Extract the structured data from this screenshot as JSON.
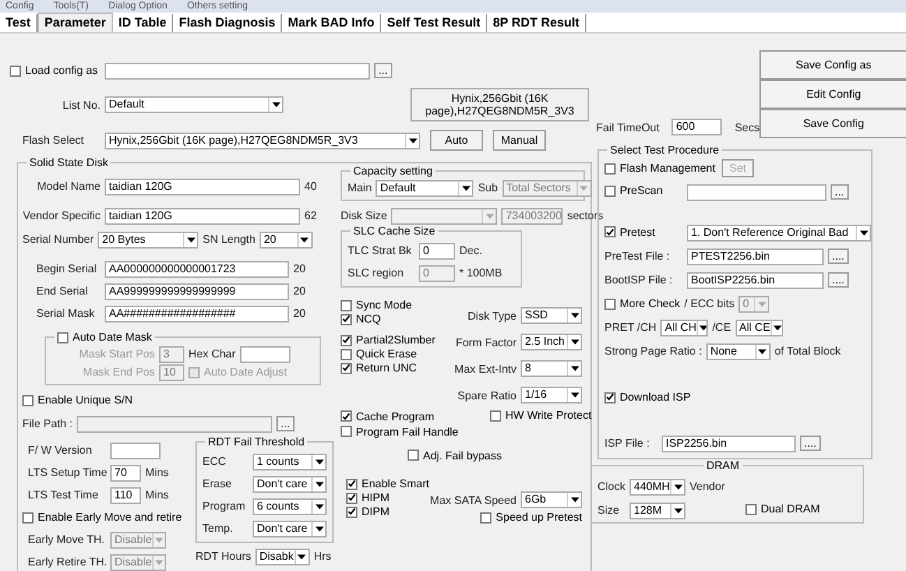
{
  "menu": [
    "Config",
    "Tools(T)",
    "Dialog Option",
    "Others setting"
  ],
  "tabs": [
    {
      "label": "Test",
      "selected": false
    },
    {
      "label": "Parameter",
      "selected": true
    },
    {
      "label": "ID Table",
      "selected": false
    },
    {
      "label": "Flash Diagnosis",
      "selected": false
    },
    {
      "label": "Mark BAD Info",
      "selected": false
    },
    {
      "label": "Self Test Result",
      "selected": false
    },
    {
      "label": "8P RDT Result",
      "selected": false
    }
  ],
  "load_config": {
    "label": "Load config as",
    "checked": false,
    "browse": "..."
  },
  "list_no": {
    "label": "List No.",
    "value": "Default"
  },
  "flash_select": {
    "label": "Flash Select",
    "value": "Hynix,256Gbit (16K page),H27QEG8NDM5R_3V3",
    "buttons": [
      "Auto",
      "Manual"
    ]
  },
  "flash_info": "Hynix,256Gbit (16K page),H27QEG8NDM5R_3V3",
  "config_buttons": [
    "Save Config as",
    "Edit Config",
    "Save Config"
  ],
  "fail_timeout": {
    "label": "Fail TimeOut",
    "value": "600",
    "unit": "Secs"
  },
  "ssd": {
    "title": "Solid State Disk",
    "names": [
      {
        "label": "Model Name",
        "value": "taidian 120G",
        "length": "40"
      },
      {
        "label": "Vendor Specific",
        "value": "taidian 120G",
        "length": "62"
      }
    ],
    "serial_number": {
      "label": "Serial Number",
      "value": "20 Bytes"
    },
    "sn_length": {
      "label": "SN Length",
      "value": "20"
    },
    "serials": [
      {
        "label": "Begin Serial",
        "value": "AA000000000000001723",
        "length": "20"
      },
      {
        "label": "End Serial",
        "value": "AA999999999999999999",
        "length": "20"
      },
      {
        "label": "Serial Mask",
        "value": "AA##################",
        "length": "20"
      }
    ],
    "auto_date_mask": {
      "label": "Auto Date Mask",
      "checked": false,
      "start": {
        "label": "Mask Start Pos",
        "value": "3",
        "disabled": true
      },
      "end": {
        "label": "Mask End Pos",
        "value": "10",
        "disabled": true
      },
      "hex_char": {
        "label": "Hex Char"
      },
      "auto_adjust": {
        "label": "Auto Date Adjust",
        "checked": false,
        "disabled": true
      }
    },
    "unique_sn": {
      "label": "Enable Unique S/N",
      "checked": false
    },
    "file_path": {
      "label": "File Path :",
      "browse": "..."
    },
    "fw_version": {
      "label": "F/ W Version"
    },
    "lts": [
      {
        "label": "LTS Setup Time",
        "value": "70",
        "unit": "Mins"
      },
      {
        "label": "LTS Test Time",
        "value": "110",
        "unit": "Mins"
      }
    ],
    "early_move": {
      "label": "Enable Early Move and retire",
      "checked": false
    },
    "early_th": [
      {
        "label": "Early Move TH.",
        "value": "Disable",
        "disabled": true
      },
      {
        "label": "Early Retire TH.",
        "value": "Disable",
        "disabled": true
      }
    ],
    "rdt_threshold": {
      "title": "RDT Fail Threshold",
      "rows": [
        {
          "label": "ECC",
          "value": "1 counts"
        },
        {
          "label": "Erase",
          "value": "Don't care"
        },
        {
          "label": "Program",
          "value": "6 counts"
        },
        {
          "label": "Temp.",
          "value": "Don't care"
        }
      ]
    },
    "rdt_hours": {
      "label": "RDT Hours",
      "value": "Disabk",
      "unit": "Hrs"
    },
    "capacity": {
      "title": "Capacity setting",
      "main": {
        "label": "Main",
        "value": "Default"
      },
      "sub": {
        "label": "Sub",
        "value": "Total Sectors",
        "disabled": true
      }
    },
    "disk_size": {
      "label": "Disk Size",
      "disabled": true,
      "sectors": "734003200",
      "unit": "sectors"
    },
    "slc": {
      "title": "SLC Cache Size",
      "rows": [
        {
          "label": "TLC Strat Bk",
          "value": "0",
          "unit": "Dec.",
          "disabled": false
        },
        {
          "label": "SLC region",
          "value": "0",
          "unit": "* 100MB",
          "disabled": true
        }
      ]
    },
    "option_groups": [
      [
        {
          "label": "Sync Mode",
          "checked": false
        },
        {
          "label": "NCQ",
          "checked": true
        }
      ],
      [
        {
          "label": "Partial2Slumber",
          "checked": true
        },
        {
          "label": "Quick Erase",
          "checked": false
        },
        {
          "label": "Return UNC",
          "checked": true
        }
      ],
      [
        {
          "label": "Cache Program",
          "checked": true
        },
        {
          "label": "Program Fail Handle",
          "checked": false
        }
      ]
    ],
    "hw_write_protect": {
      "label": "HW Write Protect",
      "checked": false
    },
    "adj_fail_bypass": {
      "label": "Adj. Fail bypass",
      "checked": false
    },
    "power_options": [
      {
        "label": "Enable Smart",
        "checked": true
      },
      {
        "label": "HIPM",
        "checked": true
      },
      {
        "label": "DIPM",
        "checked": true
      }
    ],
    "disk_selects": [
      {
        "label": "Disk Type",
        "value": "SSD"
      },
      {
        "label": "Form Factor",
        "value": "2.5 Inch"
      },
      {
        "label": "Max Ext-Intv",
        "value": "8"
      },
      {
        "label": "Spare Ratio",
        "value": "1/16"
      }
    ],
    "max_sata_speed": {
      "label": "Max SATA Speed",
      "value": "6Gb"
    },
    "speed_up_pretest": {
      "label": "Speed up Pretest",
      "checked": false
    }
  },
  "procedure": {
    "title": "Select Test Procedure",
    "flash_management": {
      "label": "Flash Management",
      "checked": false,
      "button": "Set",
      "disabled": true
    },
    "prescan": {
      "label": "PreScan",
      "checked": false,
      "browse": "..."
    },
    "pretest": {
      "label": "Pretest",
      "checked": true,
      "value": "1. Don't Reference Original Bad"
    },
    "files": [
      {
        "label": "PreTest File :",
        "value": "PTEST2256.bin",
        "browse": "...."
      },
      {
        "label": "BootISP File :",
        "value": "BootISP2256.bin",
        "browse": "...."
      }
    ],
    "more_check": {
      "label": "More Check",
      "checked": false,
      "ecc_label": "/ ECC bits",
      "ecc_value": "0",
      "disabled": true
    },
    "pret": {
      "ch_label": "PRET /CH",
      "ch_value": "All CH",
      "ce_label": "/CE",
      "ce_value": "All CE"
    },
    "strong_page": {
      "label": "Strong Page Ratio :",
      "value": "None",
      "suffix": "of Total Block"
    },
    "download_isp": {
      "label": "Download ISP",
      "checked": true
    },
    "isp_file": {
      "label": "ISP File :",
      "value": "ISP2256.bin",
      "browse": "...."
    }
  },
  "dram": {
    "title": "DRAM",
    "clock": {
      "label": "Clock",
      "value": "440MH"
    },
    "vendor": {
      "label": "Vendor"
    },
    "size": {
      "label": "Size",
      "value": "128M"
    },
    "dual": {
      "label": "Dual DRAM",
      "checked": false
    }
  }
}
